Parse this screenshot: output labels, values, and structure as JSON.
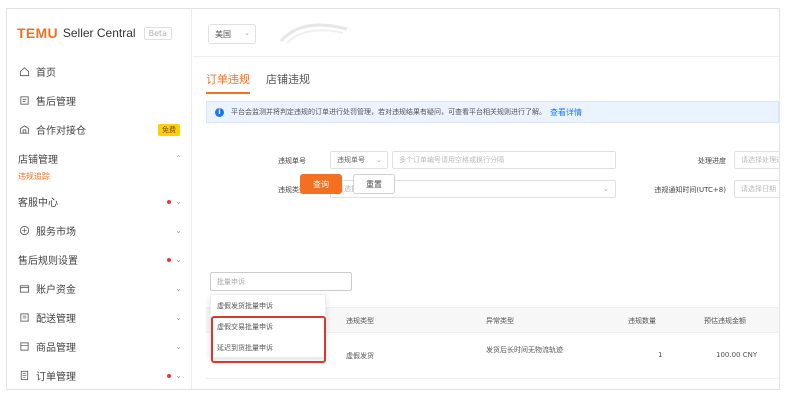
{
  "app": {
    "logo_brand": "TEMU",
    "logo_name": "Seller Central",
    "logo_badge": "Beta"
  },
  "sidebar": {
    "items": [
      {
        "label": "首页",
        "icon": "home-icon"
      },
      {
        "label": "售后管理",
        "icon": "aftersale-icon"
      },
      {
        "label": "合作对接仓",
        "icon": "warehouse-icon",
        "badge": "免费"
      },
      {
        "label": "店铺管理",
        "expanded": true,
        "sub_label": "违规追踪"
      },
      {
        "label": "客服中心",
        "dot": true
      },
      {
        "label": "服务市场",
        "icon": "market-icon"
      },
      {
        "label": "售后规则设置",
        "dot": true
      },
      {
        "label": "账户资金",
        "icon": "wallet-icon"
      },
      {
        "label": "配送管理",
        "icon": "delivery-icon"
      },
      {
        "label": "商品管理",
        "icon": "goods-icon"
      },
      {
        "label": "订单管理",
        "icon": "order-icon",
        "dot": true
      }
    ]
  },
  "topbar": {
    "region_value": "美国"
  },
  "tabs": [
    {
      "label": "订单违规",
      "active": true
    },
    {
      "label": "店铺违规",
      "active": false
    }
  ],
  "notice": {
    "text": "平台会监测并将判定违规的订单进行处罚管理，若对违规结果有疑问，可查看平台相关规则进行了解。",
    "link": "查看详情"
  },
  "filters": {
    "search_label": "违规单号",
    "search_type": "违规单号",
    "search_placeholder": "多个订单编号请用空格或换行分隔",
    "violation_type_label": "违规类型",
    "violation_type_placeholder": "请选择违规类型",
    "status_label": "处理进度",
    "status_placeholder": "请选择处理进度",
    "time_label": "违规通知时间(UTC+8)",
    "time_placeholder": "请选择日期",
    "query_button": "查询",
    "reset_button": "重置"
  },
  "batch": {
    "placeholder": "批量申诉",
    "options": [
      "虚假发货批量申诉",
      "虚假交易批量申诉",
      "延迟到货批量申诉"
    ]
  },
  "table": {
    "columns": [
      "违规类型",
      "异常类型",
      "违规数量",
      "预估违规金额"
    ],
    "rows": [
      {
        "type": "虚假发货",
        "exception": "发货后长时间无物流轨迹",
        "count": "1",
        "amount": "100.00 CNY"
      }
    ]
  }
}
